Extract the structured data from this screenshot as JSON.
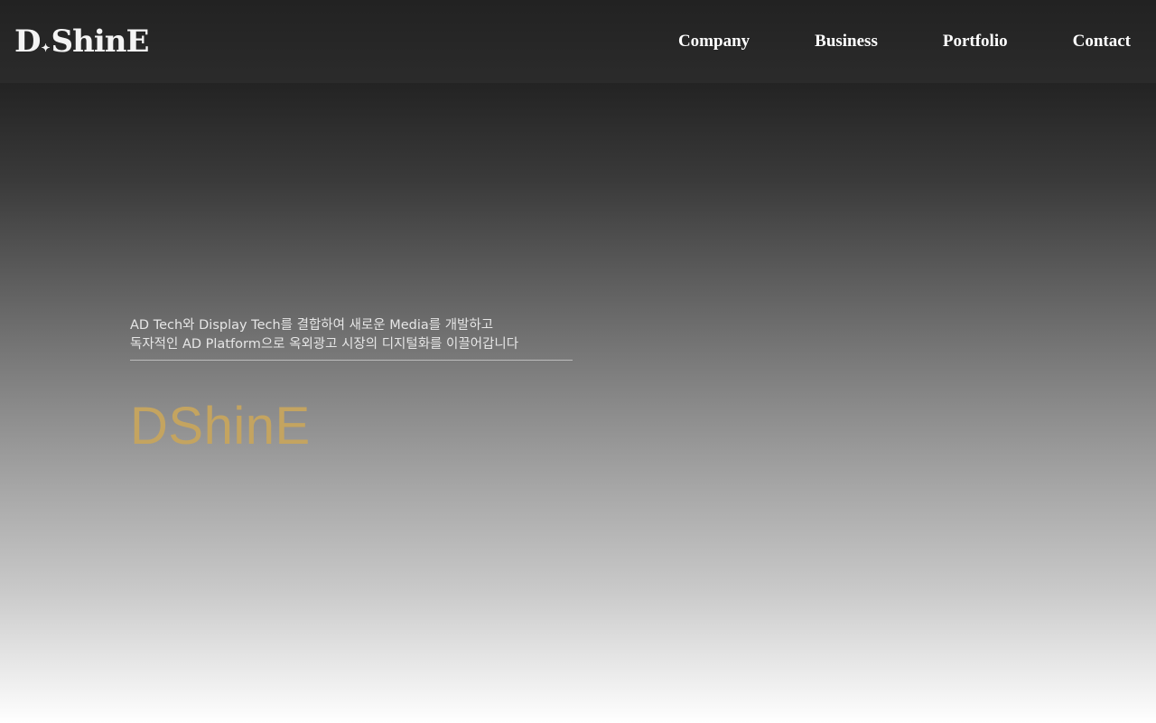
{
  "header": {
    "logo": {
      "left": "D",
      "star": "✦",
      "right": "ShinE"
    },
    "nav": [
      {
        "label": "Company"
      },
      {
        "label": "Business"
      },
      {
        "label": "Portfolio"
      },
      {
        "label": "Contact"
      }
    ]
  },
  "hero": {
    "tagline_line1": "AD Tech와 Display Tech를 결합하여 새로운 Media를 개발하고",
    "tagline_line2": "독자적인 AD Platform으로 옥외광고 시장의 디지털화를 이끌어갑니다",
    "brand": "DShinE"
  },
  "colors": {
    "brand_accent": "#c4a460",
    "header_bg": "#262626",
    "nav_text": "#ffffff"
  }
}
